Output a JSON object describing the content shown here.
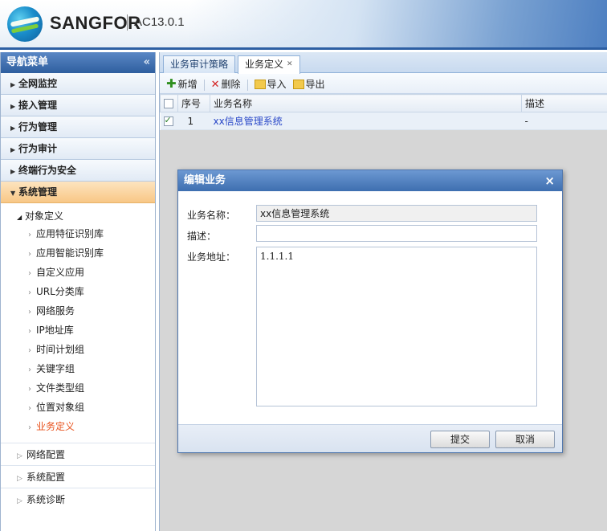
{
  "header": {
    "brand": "SANGFOR",
    "version": "AC13.0.1"
  },
  "sidebar": {
    "title": "导航菜单",
    "collapse_glyph": "«",
    "sections": [
      {
        "label": "全网监控"
      },
      {
        "label": "接入管理"
      },
      {
        "label": "行为管理"
      },
      {
        "label": "行为审计"
      },
      {
        "label": "终端行为安全"
      }
    ],
    "active_section": "系统管理",
    "group": "对象定义",
    "items": [
      {
        "label": "应用特征识别库"
      },
      {
        "label": "应用智能识别库"
      },
      {
        "label": "自定义应用"
      },
      {
        "label": "URL分类库"
      },
      {
        "label": "网络服务"
      },
      {
        "label": "IP地址库"
      },
      {
        "label": "时间计划组"
      },
      {
        "label": "关键字组"
      },
      {
        "label": "文件类型组"
      },
      {
        "label": "位置对象组"
      },
      {
        "label": "业务定义"
      }
    ],
    "sub_sections": [
      {
        "label": "网络配置"
      },
      {
        "label": "系统配置"
      },
      {
        "label": "系统诊断"
      }
    ]
  },
  "tabs": [
    {
      "label": "业务审计策略"
    },
    {
      "label": "业务定义"
    }
  ],
  "toolbar": {
    "add": "新增",
    "delete": "删除",
    "import": "导入",
    "export": "导出"
  },
  "table": {
    "columns": [
      "序号",
      "业务名称",
      "描述"
    ],
    "rows": [
      {
        "index": "1",
        "name": "xx信息管理系统",
        "desc": "-",
        "checked": true
      }
    ]
  },
  "dialog": {
    "title": "编辑业务",
    "close_glyph": "×",
    "name_label": "业务名称：",
    "name_value": "xx信息管理系统",
    "desc_label": "描述：",
    "desc_value": "",
    "address_label": "业务地址：",
    "address_value": "1.1.1.1",
    "submit": "提交",
    "cancel": "取消"
  }
}
